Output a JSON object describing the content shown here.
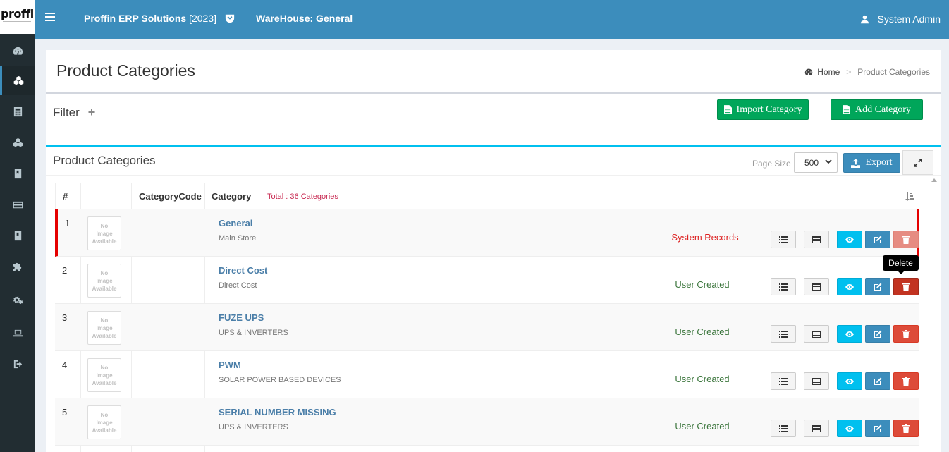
{
  "brand": {
    "logo_text": "proffin"
  },
  "topbar": {
    "company": "Proffin ERP Solutions",
    "year": "[2023]",
    "warehouse": "WareHouse: General",
    "user": "System Admin"
  },
  "sidebar": {
    "items": [
      {
        "icon": "dashboard-icon"
      },
      {
        "icon": "cubes-icon",
        "active": true
      },
      {
        "icon": "calculator-icon"
      },
      {
        "icon": "cubes-alt-icon"
      },
      {
        "icon": "book-icon"
      },
      {
        "icon": "credit-card-icon"
      },
      {
        "icon": "book-alt-icon"
      },
      {
        "icon": "puzzle-icon"
      },
      {
        "icon": "cogs-icon"
      },
      {
        "icon": "laptop-icon"
      },
      {
        "icon": "sign-out-icon"
      }
    ]
  },
  "page": {
    "title": "Product Categories",
    "breadcrumb_home": "Home",
    "breadcrumb_current": "Product Categories"
  },
  "filter": {
    "label": "Filter"
  },
  "buttons": {
    "import": "Import Category",
    "add": "Add Category",
    "export": "Export"
  },
  "box": {
    "title": "Product Categories",
    "page_size_label": "Page Size",
    "page_size": "500"
  },
  "table": {
    "headers": {
      "num": "#",
      "code": "CategoryCode",
      "category": "Category"
    },
    "total": "Total : 36 Categories",
    "no_image": [
      "No",
      "Image",
      "Available"
    ],
    "rows": [
      {
        "num": "1",
        "name": "General",
        "sub": "Main Store",
        "status": "System Records"
      },
      {
        "num": "2",
        "name": "Direct Cost",
        "sub": "Direct Cost",
        "status": "User Created"
      },
      {
        "num": "3",
        "name": "FUZE UPS",
        "sub": "UPS & INVERTERS",
        "status": "User Created"
      },
      {
        "num": "4",
        "name": "PWM",
        "sub": "SOLAR POWER BASED DEVICES",
        "status": "User Created"
      },
      {
        "num": "5",
        "name": "SERIAL NUMBER MISSING",
        "sub": "UPS & INVERTERS",
        "status": "User Created"
      }
    ]
  },
  "tooltip": {
    "text": "Delete"
  },
  "colors": {
    "topbar": "#3c8dbc",
    "sidebar": "#222d32",
    "success": "#00a65a",
    "info": "#00c0ef",
    "danger": "#dd4b39"
  }
}
